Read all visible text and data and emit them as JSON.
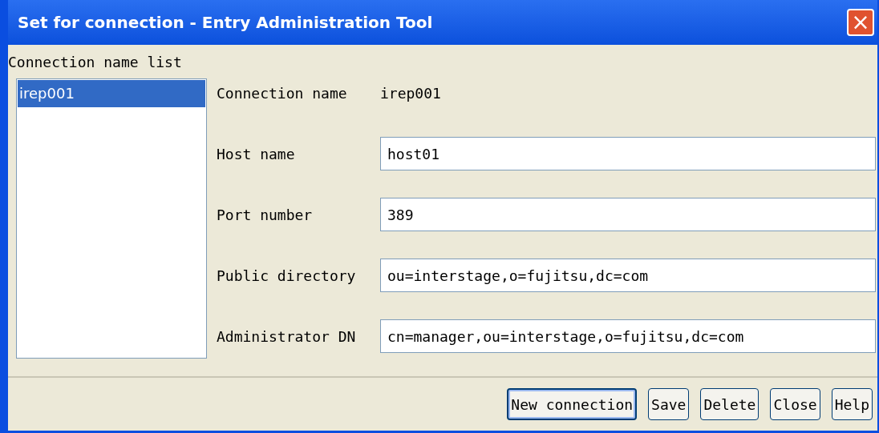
{
  "window": {
    "title": "Set for connection - Entry Administration Tool",
    "close_button": "×"
  },
  "list": {
    "label": "Connection name list",
    "items": [
      {
        "label": "irep001",
        "selected": true
      }
    ]
  },
  "fields": [
    {
      "kind": "text",
      "label": "Connection name",
      "value": "irep001"
    },
    {
      "kind": "input",
      "label": "Host name",
      "value": "host01"
    },
    {
      "kind": "input",
      "label": "Port number",
      "value": "389"
    },
    {
      "kind": "input",
      "label": "Public directory",
      "value": "ou=interstage,o=fujitsu,dc=com"
    },
    {
      "kind": "input",
      "label": "Administrator DN",
      "value": "cn=manager,ou=interstage,o=fujitsu,dc=com"
    }
  ],
  "buttons": [
    {
      "label": "New connection",
      "default": true
    },
    {
      "label": "Save",
      "default": false
    },
    {
      "label": "Delete",
      "default": false
    },
    {
      "label": "Close",
      "default": false
    },
    {
      "label": "Help",
      "default": false
    }
  ]
}
